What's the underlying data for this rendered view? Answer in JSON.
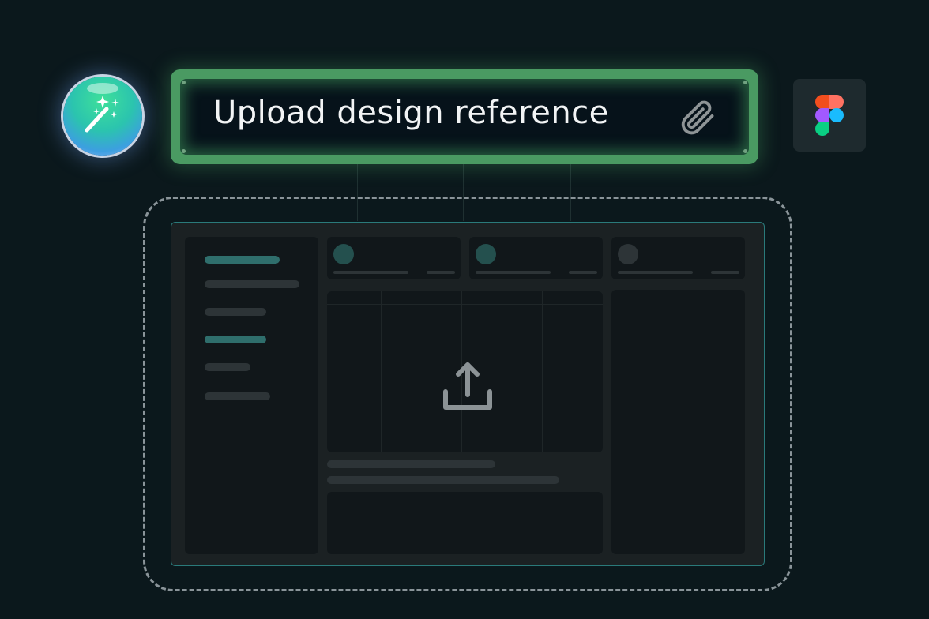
{
  "prompt": {
    "label": "Upload design reference"
  },
  "icons": {
    "orb": "magic-wand-icon",
    "attach": "paperclip-icon",
    "figma": "figma-logo-icon",
    "upload": "upload-icon"
  },
  "colors": {
    "background": "#0b181c",
    "prompt_border": "#4a9a62",
    "prompt_fill": "#06121a",
    "text": "#f2f4f5",
    "accent": "#2f6e6c",
    "dropzone_border": "#8a9499"
  }
}
